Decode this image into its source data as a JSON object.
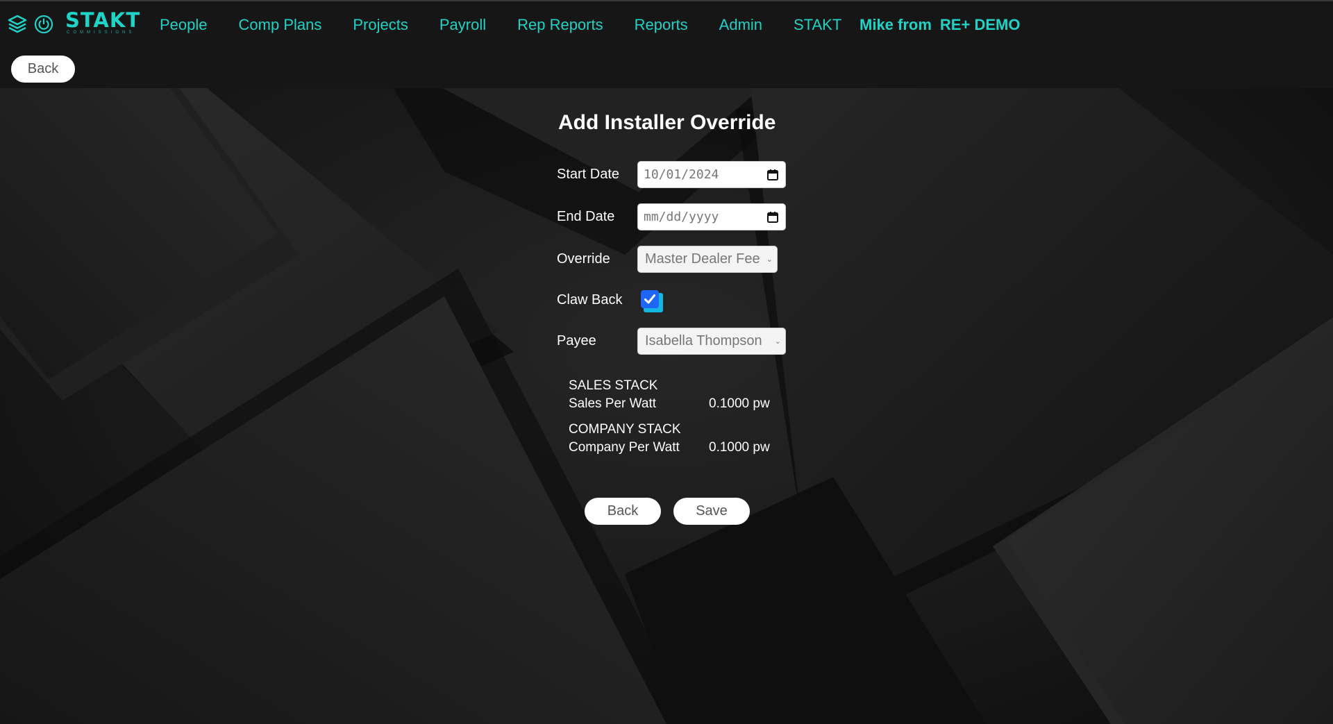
{
  "header": {
    "brand": "STAKT",
    "brand_sub": "COMMISSIONS",
    "nav": [
      {
        "label": "People"
      },
      {
        "label": "Comp Plans"
      },
      {
        "label": "Projects"
      },
      {
        "label": "Payroll"
      },
      {
        "label": "Rep Reports"
      },
      {
        "label": "Reports"
      },
      {
        "label": "Admin"
      },
      {
        "label": "STAKT"
      }
    ],
    "user_from": "Mike from",
    "org": "RE+ DEMO",
    "back_label": "Back",
    "accent_color": "#1fd3c6"
  },
  "form": {
    "title": "Add Installer Override",
    "start_date": {
      "label": "Start Date",
      "value": "10/01/2024"
    },
    "end_date": {
      "label": "End Date",
      "placeholder": "mm/dd/yyyy"
    },
    "override": {
      "label": "Override",
      "value": "Master Dealer Fee"
    },
    "claw_back": {
      "label": "Claw Back",
      "checked": true
    },
    "payee": {
      "label": "Payee",
      "value": "Isabella Thompson"
    },
    "sales_stack": {
      "heading": "SALES STACK",
      "row_label": "Sales Per Watt",
      "row_value": "0.1000 pw"
    },
    "company_stack": {
      "heading": "COMPANY STACK",
      "row_label": "Company Per Watt",
      "row_value": "0.1000 pw"
    },
    "back_label": "Back",
    "save_label": "Save"
  },
  "icons": [
    "stack-layers-icon",
    "power-icon",
    "calendar-icon",
    "chevron-down-icon",
    "checkmark-icon"
  ]
}
